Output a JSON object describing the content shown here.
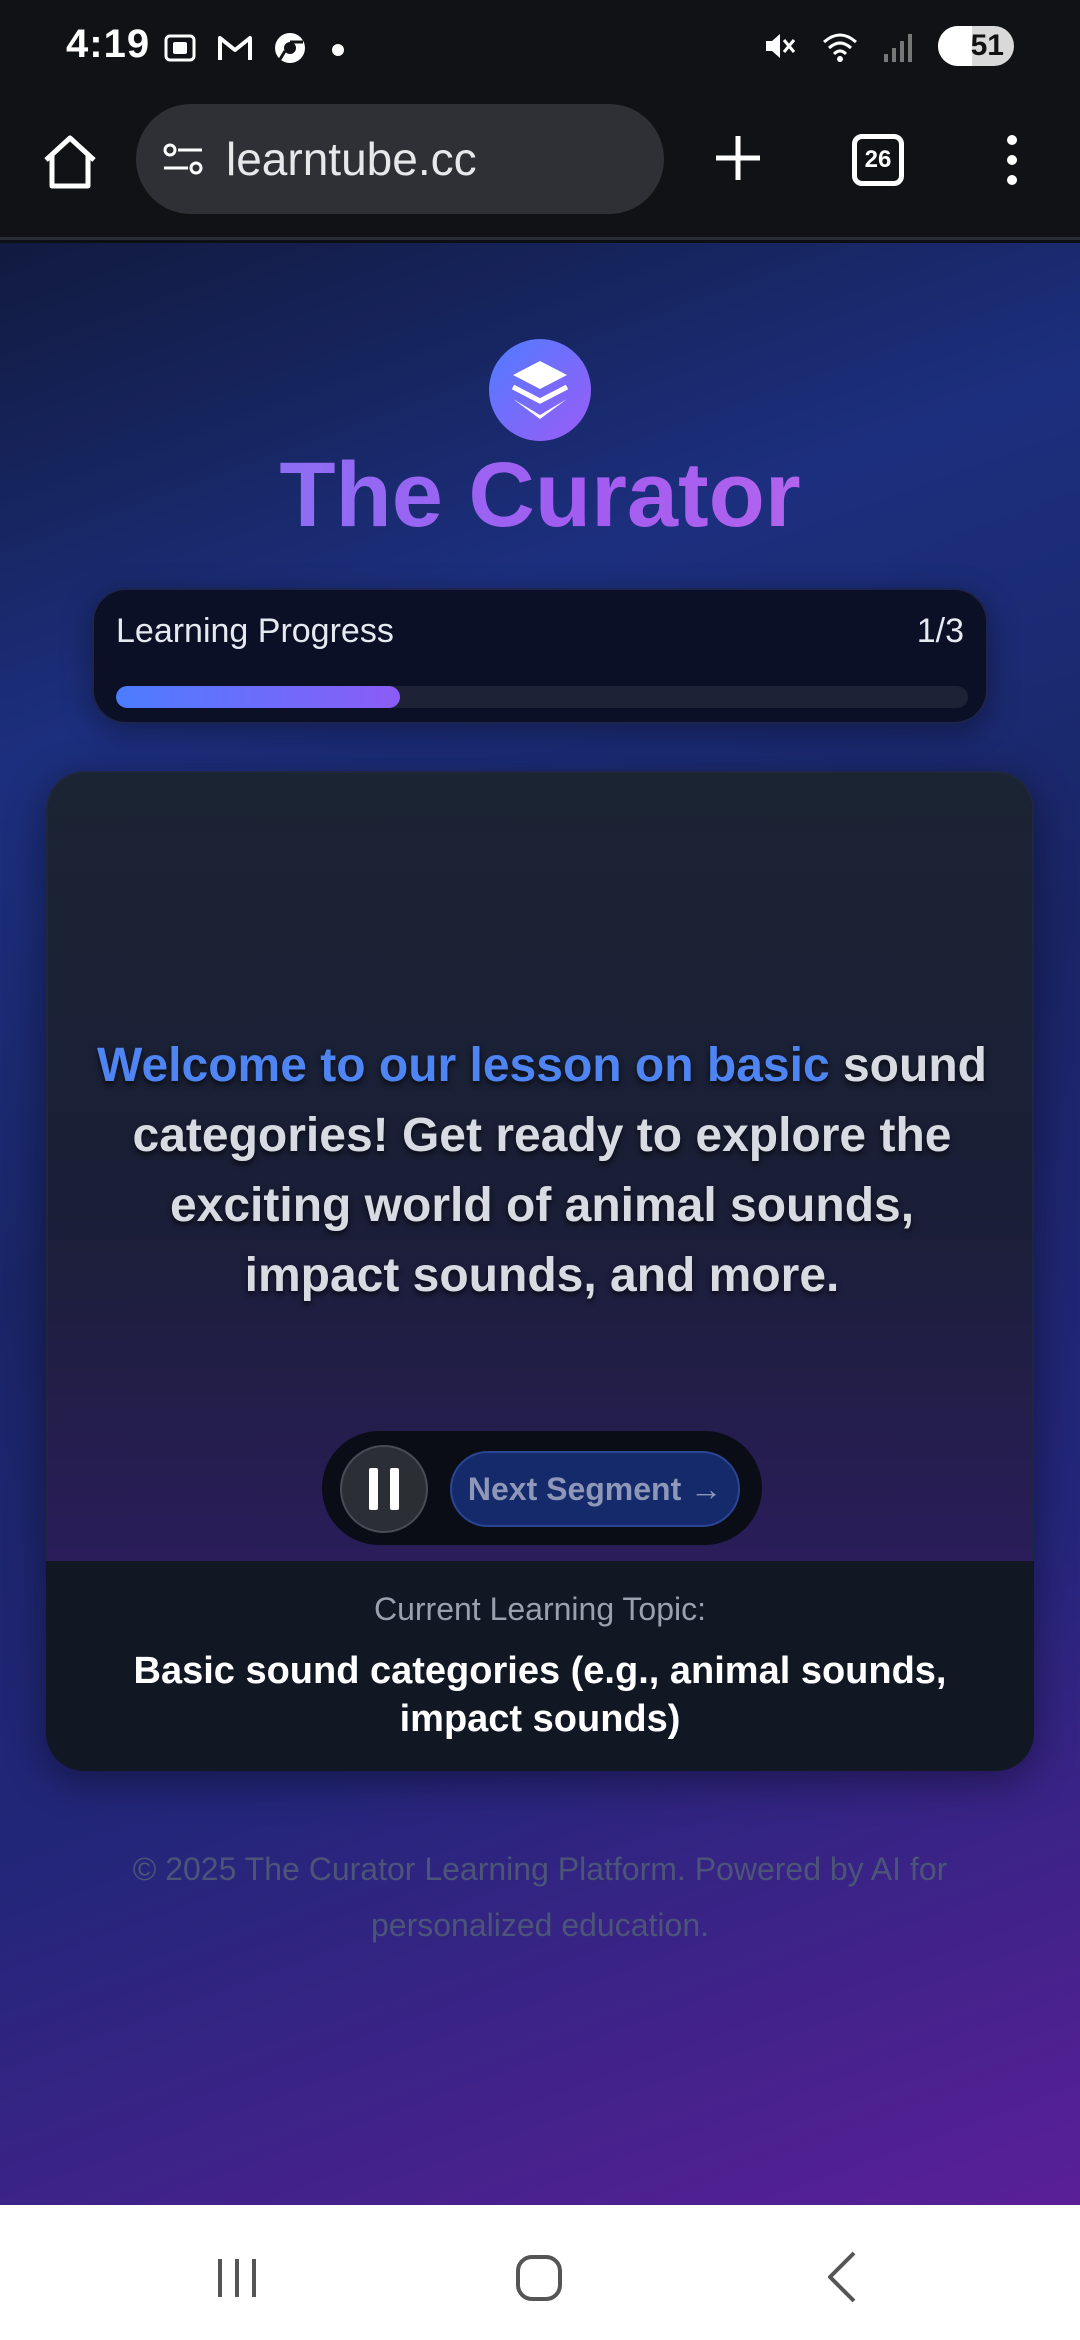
{
  "status_bar": {
    "time": "4:19",
    "battery": "51",
    "left_icons": [
      "screenshot-icon",
      "gmail-icon",
      "chrome-icon",
      "dot-icon"
    ],
    "right_icons": [
      "mute-icon",
      "wifi-icon",
      "signal-icon",
      "battery-icon"
    ]
  },
  "browser": {
    "url": "learntube.cc",
    "tab_count": "26"
  },
  "app": {
    "title": "The Curator",
    "progress": {
      "label": "Learning Progress",
      "count": "1/3",
      "fraction": 0.333
    },
    "lesson": {
      "caption_highlight": "Welcome to our lesson on basic",
      "caption_rest": "sound categories!  Get ready to explore the exciting world of animal sounds, impact sounds, and more.",
      "next_button": "Next Segment →"
    },
    "topic": {
      "label": "Current Learning Topic:",
      "value": "Basic sound categories (e.g., animal sounds, impact sounds)"
    },
    "footer": "© 2025 The Curator Learning Platform. Powered by AI for personalized education."
  },
  "colors": {
    "accent_blue": "#4e85f2",
    "accent_purple": "#9b5cf6"
  }
}
